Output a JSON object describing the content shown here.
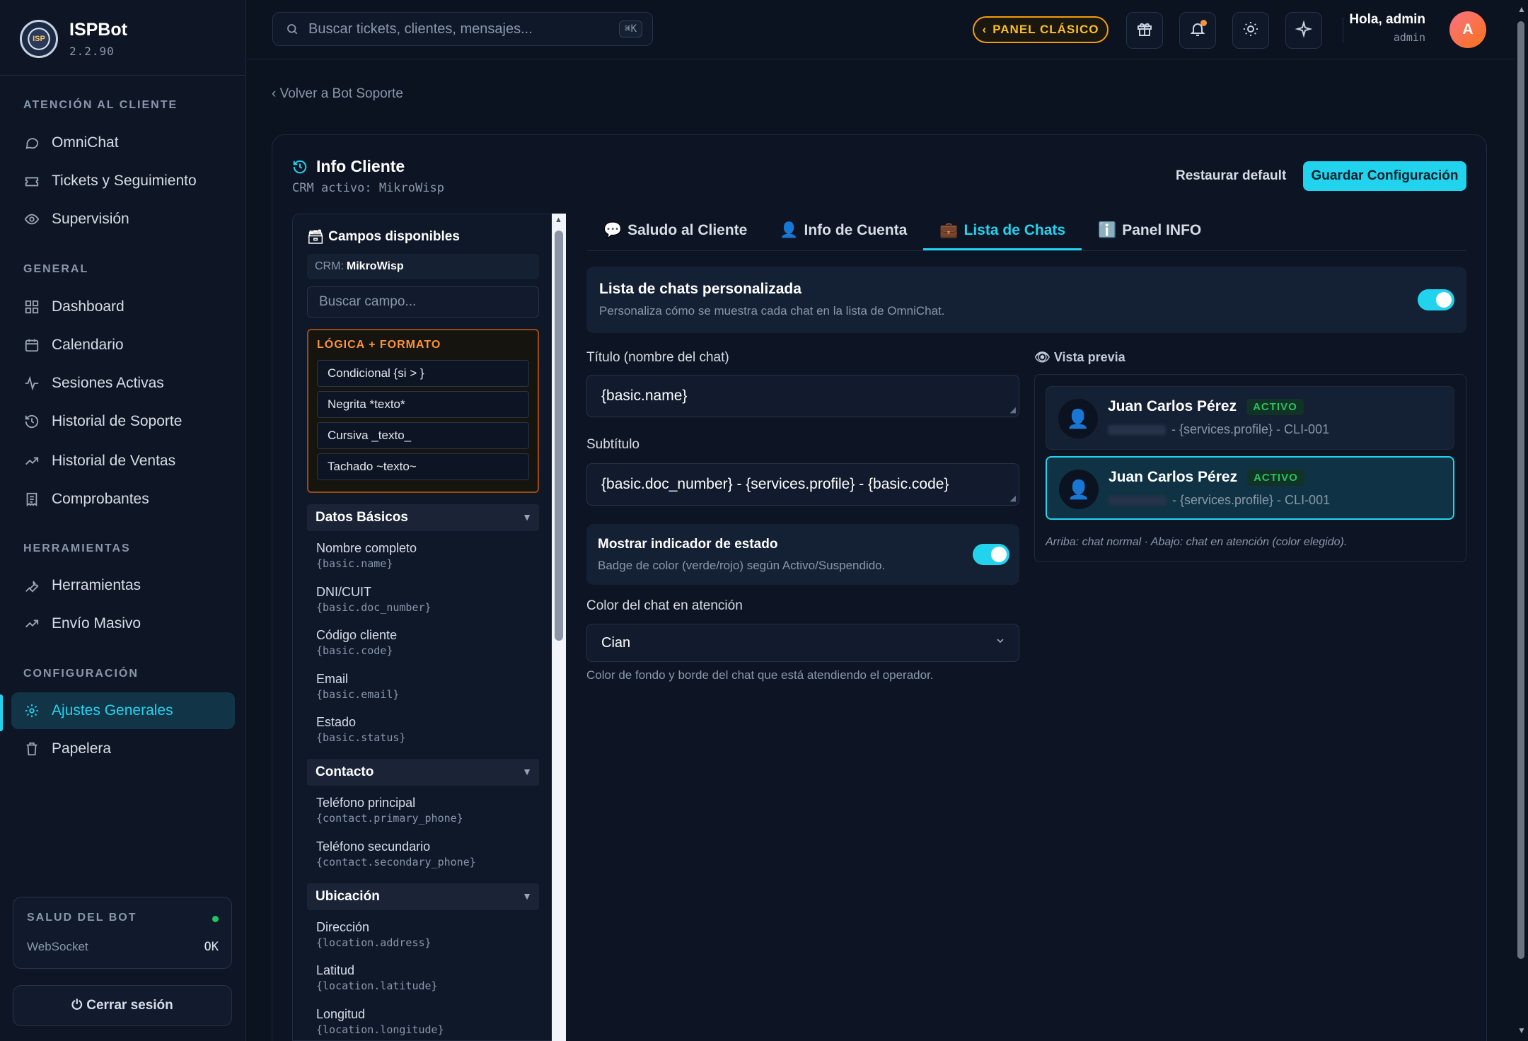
{
  "app": {
    "name": "ISPBot",
    "version": "2.2.90"
  },
  "sidebar": {
    "sections": [
      {
        "title": "ATENCIÓN AL CLIENTE",
        "items": [
          {
            "label": "OmniChat",
            "icon": "chat-bubble-icon"
          },
          {
            "label": "Tickets y Seguimiento",
            "icon": "ticket-icon"
          },
          {
            "label": "Supervisión",
            "icon": "eye-icon"
          }
        ]
      },
      {
        "title": "GENERAL",
        "items": [
          {
            "label": "Dashboard",
            "icon": "grid-icon"
          },
          {
            "label": "Calendario",
            "icon": "calendar-icon"
          },
          {
            "label": "Sesiones Activas",
            "icon": "activity-icon"
          },
          {
            "label": "Historial de Soporte",
            "icon": "history-icon"
          },
          {
            "label": "Historial de Ventas",
            "icon": "trending-icon"
          },
          {
            "label": "Comprobantes",
            "icon": "receipt-icon"
          }
        ]
      },
      {
        "title": "HERRAMIENTAS",
        "items": [
          {
            "label": "Herramientas",
            "icon": "wrench-icon"
          },
          {
            "label": "Envío Masivo",
            "icon": "trending-icon"
          }
        ]
      },
      {
        "title": "CONFIGURACIÓN",
        "items": [
          {
            "label": "Ajustes Generales",
            "icon": "gear-icon",
            "active": true
          },
          {
            "label": "Papelera",
            "icon": "trash-icon"
          }
        ]
      }
    ],
    "health": {
      "title": "SALUD DEL BOT",
      "label": "WebSocket",
      "value": "OK"
    },
    "logout": "Cerrar sesión"
  },
  "topbar": {
    "search_placeholder": "Buscar tickets, clientes, mensajes...",
    "shortcut": "⌘K",
    "classic_button": "PANEL CLÁSICO",
    "user_greeting": "Hola, admin",
    "user_role": "admin",
    "avatar_letter": "A"
  },
  "page": {
    "back_link": "‹ Volver a Bot Soporte",
    "title": "Info Cliente",
    "subtitle": "CRM activo: MikroWisp",
    "restore_button": "Restaurar default",
    "save_button": "Guardar Configuración"
  },
  "fields_panel": {
    "title": "Campos disponibles",
    "crm_label": "CRM:",
    "crm_value": "MikroWisp",
    "search_placeholder": "Buscar campo...",
    "logic_title": "LÓGICA + FORMATO",
    "logic_items": [
      "Condicional {si > }",
      "Negrita *texto*",
      "Cursiva _texto_",
      "Tachado ~texto~"
    ],
    "groups": [
      {
        "title": "Datos Básicos",
        "fields": [
          {
            "name": "Nombre completo",
            "key": "{basic.name}"
          },
          {
            "name": "DNI/CUIT",
            "key": "{basic.doc_number}"
          },
          {
            "name": "Código cliente",
            "key": "{basic.code}"
          },
          {
            "name": "Email",
            "key": "{basic.email}"
          },
          {
            "name": "Estado",
            "key": "{basic.status}"
          }
        ]
      },
      {
        "title": "Contacto",
        "fields": [
          {
            "name": "Teléfono principal",
            "key": "{contact.primary_phone}"
          },
          {
            "name": "Teléfono secundario",
            "key": "{contact.secondary_phone}"
          }
        ]
      },
      {
        "title": "Ubicación",
        "fields": [
          {
            "name": "Dirección",
            "key": "{location.address}"
          },
          {
            "name": "Latitud",
            "key": "{location.latitude}"
          },
          {
            "name": "Longitud",
            "key": "{location.longitude}"
          }
        ]
      }
    ]
  },
  "tabs": [
    {
      "emoji": "💬",
      "label": "Saludo al Cliente"
    },
    {
      "emoji": "👤",
      "label": "Info de Cuenta"
    },
    {
      "emoji": "💼",
      "label": "Lista de Chats",
      "active": true
    },
    {
      "emoji": "ℹ️",
      "label": "Panel INFO"
    }
  ],
  "chat_list": {
    "custom_title": "Lista de chats personalizada",
    "custom_desc": "Personaliza cómo se muestra cada chat en la lista de OmniChat.",
    "custom_enabled": true,
    "title_label": "Título (nombre del chat)",
    "title_value": "{basic.name}",
    "subtitle_label": "Subtítulo",
    "subtitle_value": "{basic.doc_number} - {services.profile} - {basic.code}",
    "status_title": "Mostrar indicador de estado",
    "status_desc": "Badge de color (verde/rojo) según Activo/Suspendido.",
    "status_enabled": true,
    "color_label": "Color del chat en atención",
    "color_value": "Cian",
    "color_help": "Color de fondo y borde del chat que está atendiendo el operador.",
    "preview_label": "Vista previa",
    "preview_name": "Juan Carlos Pérez",
    "preview_badge": "ACTIVO",
    "preview_subtitle": "- {services.profile} - CLI-001",
    "preview_note": "Arriba: chat normal · Abajo: chat en atención (color elegido).",
    "accent_color": "#22d3ee"
  }
}
